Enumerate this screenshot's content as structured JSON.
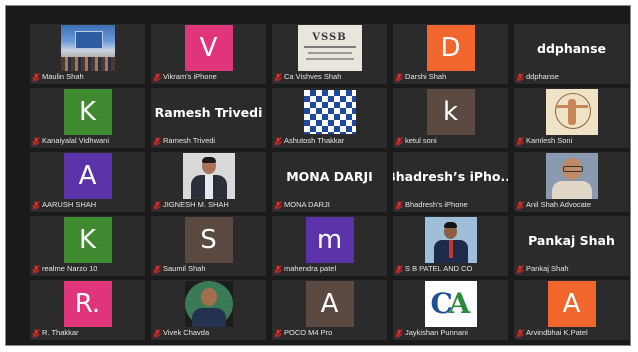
{
  "gallery": {
    "tiles": [
      {
        "name": "Maulin Shah",
        "kind": "photo",
        "photo": "conference-photo"
      },
      {
        "name": "Vikram's iPhone",
        "kind": "avatar",
        "initial": "V",
        "color": "#e0357a"
      },
      {
        "name": "Ca Vishves Shah",
        "kind": "photo",
        "photo": "vssb-logo",
        "logo_text": "VSSB"
      },
      {
        "name": "Darshi Shah",
        "kind": "avatar",
        "initial": "D",
        "color": "#f0662c"
      },
      {
        "name": "ddphanse",
        "kind": "text"
      },
      {
        "name": "Kanaiyalal Vidhwani",
        "kind": "avatar",
        "initial": "K",
        "color": "#3f8a31"
      },
      {
        "name": "Ramesh Trivedi",
        "kind": "text"
      },
      {
        "name": "Ashutosh Thakkar",
        "kind": "photo",
        "photo": "checker-pattern"
      },
      {
        "name": "ketul soni",
        "kind": "avatar",
        "initial": "k",
        "color": "#5b4a42"
      },
      {
        "name": "Kamlesh Soni",
        "kind": "photo",
        "photo": "vitruvian-image"
      },
      {
        "name": "AARUSH SHAH",
        "kind": "avatar",
        "initial": "A",
        "color": "#5b32a8"
      },
      {
        "name": "JIGNESH M. SHAH",
        "kind": "photo",
        "photo": "man-portrait"
      },
      {
        "name": "MONA DARJI",
        "kind": "text"
      },
      {
        "name": "Bhadresh's iPhone",
        "kind": "text",
        "display": "Bhadresh’s iPho..."
      },
      {
        "name": "Anil Shah Advocate",
        "kind": "photo",
        "photo": "elderly-man-portrait"
      },
      {
        "name": "realme Narzo 10",
        "kind": "avatar",
        "initial": "K",
        "color": "#3f8a31"
      },
      {
        "name": "Saumil Shah",
        "kind": "avatar",
        "initial": "S",
        "color": "#5b4a42"
      },
      {
        "name": "mahendra patel",
        "kind": "avatar",
        "initial": "m",
        "color": "#5b32a8"
      },
      {
        "name": "S B PATEL AND CO",
        "kind": "photo",
        "photo": "man-in-suit"
      },
      {
        "name": "Pankaj Shah",
        "kind": "text"
      },
      {
        "name": "R. Thakkar",
        "kind": "avatar",
        "initial": "R.",
        "color": "#e0357a"
      },
      {
        "name": "Vivek Chavda",
        "kind": "photo",
        "photo": "round-portrait"
      },
      {
        "name": "POCO M4 Pro",
        "kind": "avatar",
        "initial": "A",
        "color": "#5b4a42"
      },
      {
        "name": "Jaykishan Punnani",
        "kind": "photo",
        "photo": "ca-logo",
        "logo_text": "CA"
      },
      {
        "name": "Arvindbhai K.Patel",
        "kind": "avatar",
        "initial": "A",
        "color": "#f0662c"
      }
    ],
    "muted_icon": "muted-mic-icon",
    "colors": {
      "tile_bg": "#2b2b2b",
      "frame_bg": "#1a1a1a",
      "muted_red": "#e02b2b"
    }
  }
}
